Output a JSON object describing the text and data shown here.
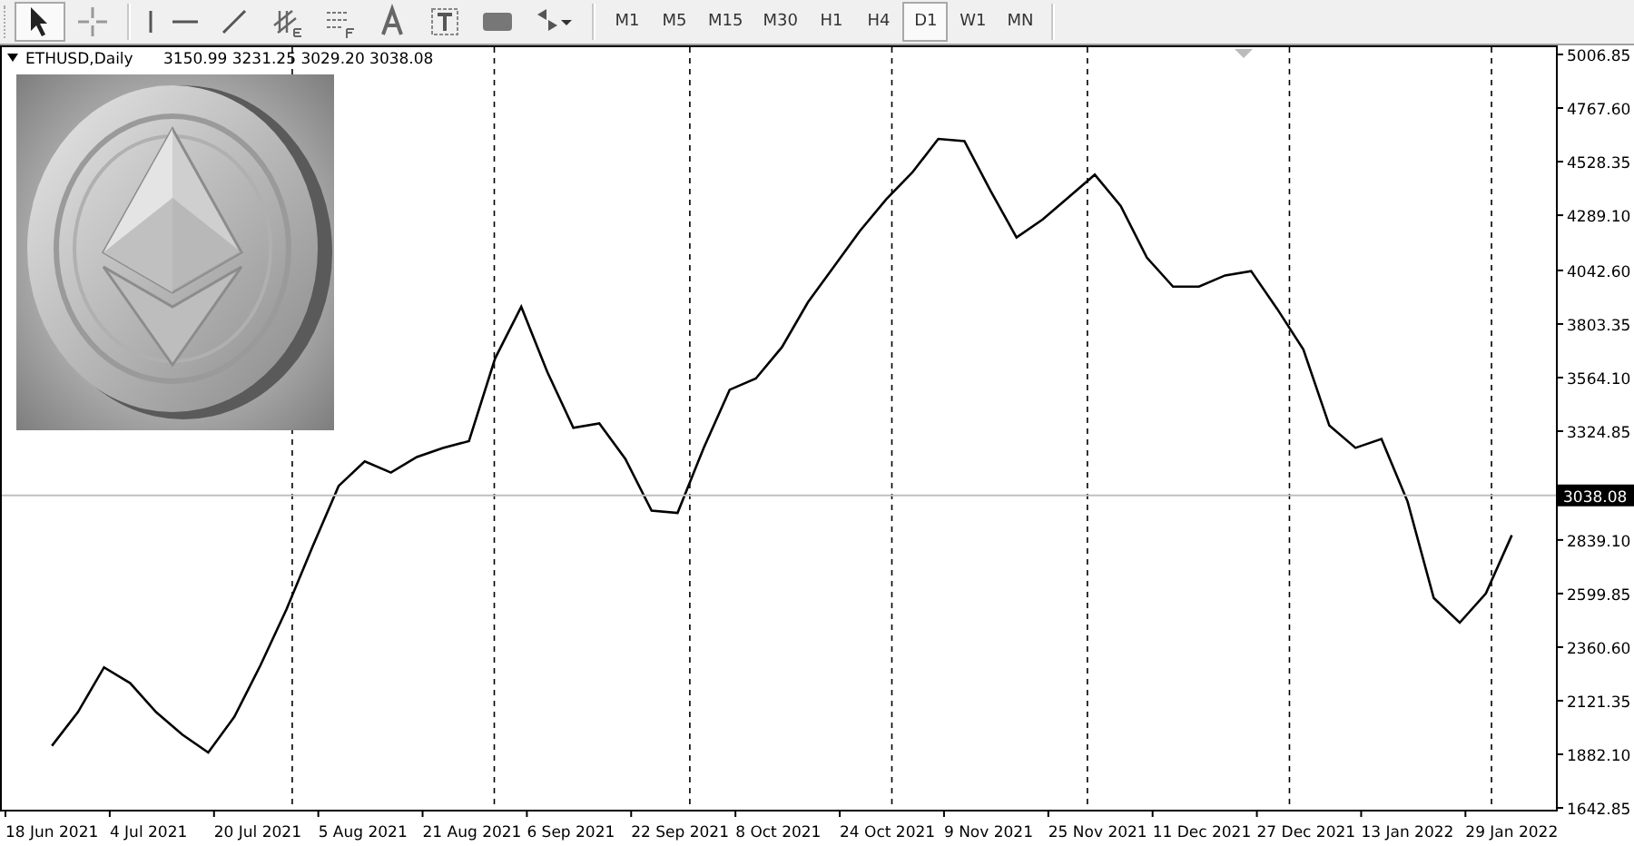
{
  "toolbar": {
    "tools": [
      {
        "kind": "cursor",
        "selected": true
      },
      {
        "kind": "crosshair",
        "selected": false
      },
      {
        "kind": "vline",
        "selected": false
      },
      {
        "kind": "hline",
        "selected": false
      },
      {
        "kind": "trendline",
        "selected": false
      },
      {
        "kind": "channel",
        "selected": false
      },
      {
        "kind": "fibo",
        "selected": false
      },
      {
        "kind": "text",
        "selected": false
      },
      {
        "kind": "label",
        "selected": false
      },
      {
        "kind": "rect",
        "selected": false
      },
      {
        "kind": "arrows",
        "selected": false
      }
    ],
    "periods": [
      {
        "label": "M1",
        "selected": false
      },
      {
        "label": "M5",
        "selected": false
      },
      {
        "label": "M15",
        "selected": false
      },
      {
        "label": "M30",
        "selected": false
      },
      {
        "label": "H1",
        "selected": false
      },
      {
        "label": "H4",
        "selected": false
      },
      {
        "label": "D1",
        "selected": true
      },
      {
        "label": "W1",
        "selected": false
      },
      {
        "label": "MN",
        "selected": false
      }
    ]
  },
  "chart": {
    "symbol": "ETHUSD,Daily",
    "ohlc": "3150.99 3231.25 3029.20 3038.08",
    "chart_data": {
      "type": "line",
      "categories": [
        "18 Jun 2021",
        null,
        null,
        null,
        "4 Jul 2021",
        null,
        null,
        null,
        "20 Jul 2021",
        null,
        null,
        null,
        "5 Aug 2021",
        null,
        null,
        null,
        "21 Aug 2021",
        null,
        null,
        null,
        "6 Sep 2021",
        null,
        null,
        null,
        "22 Sep 2021",
        null,
        null,
        null,
        "8 Oct 2021",
        null,
        null,
        null,
        "24 Oct 2021",
        null,
        null,
        null,
        "9 Nov 2021",
        null,
        null,
        null,
        "25 Nov 2021",
        null,
        null,
        null,
        "11 Dec 2021",
        null,
        null,
        null,
        "27 Dec 2021",
        null,
        null,
        null,
        "13 Jan 2022",
        null,
        null,
        null,
        "29 Jan 2022"
      ],
      "series": [
        {
          "color": "#000000",
          "values": [
            1920,
            2070,
            2270,
            2200,
            2070,
            1970,
            1890,
            2050,
            2280,
            2530,
            2810,
            3080,
            3190,
            3140,
            3210,
            3250,
            3280,
            3650,
            3880,
            3590,
            3340,
            3360,
            3200,
            2970,
            2960,
            3250,
            3510,
            3560,
            3700,
            3900,
            4060,
            4220,
            4360,
            4480,
            4630,
            4620,
            4400,
            4190,
            4270,
            4370,
            4470,
            4330,
            4100,
            3970,
            3970,
            4020,
            4040,
            3870,
            3690,
            3350,
            3250,
            3290,
            3010,
            2580,
            2470,
            2600,
            2860
          ]
        }
      ],
      "ylim": [
        1630.7,
        5043.3
      ],
      "ref_lines": [
        {
          "axis": "y",
          "value": 3038.08,
          "label": "3038.08",
          "color": "#c0c0c0"
        }
      ],
      "yticks": [
        {
          "value": 5006.85,
          "label": "5006.85"
        },
        {
          "value": 4767.6,
          "label": "4767.60"
        },
        {
          "value": 4528.35,
          "label": "4528.35"
        },
        {
          "value": 4289.1,
          "label": "4289.10"
        },
        {
          "value": 4042.6,
          "label": "4042.60"
        },
        {
          "value": 3803.35,
          "label": "3803.35"
        },
        {
          "value": 3564.1,
          "label": "3564.10"
        },
        {
          "value": 3324.85,
          "label": "3324.85"
        },
        {
          "value": 2839.1,
          "label": "2839.10"
        },
        {
          "value": 2599.85,
          "label": "2599.85"
        },
        {
          "value": 2360.6,
          "label": "2360.60"
        },
        {
          "value": 2121.35,
          "label": "2121.35"
        },
        {
          "value": 1882.1,
          "label": "1882.10"
        },
        {
          "value": 1642.85,
          "label": "1642.85"
        }
      ]
    }
  }
}
